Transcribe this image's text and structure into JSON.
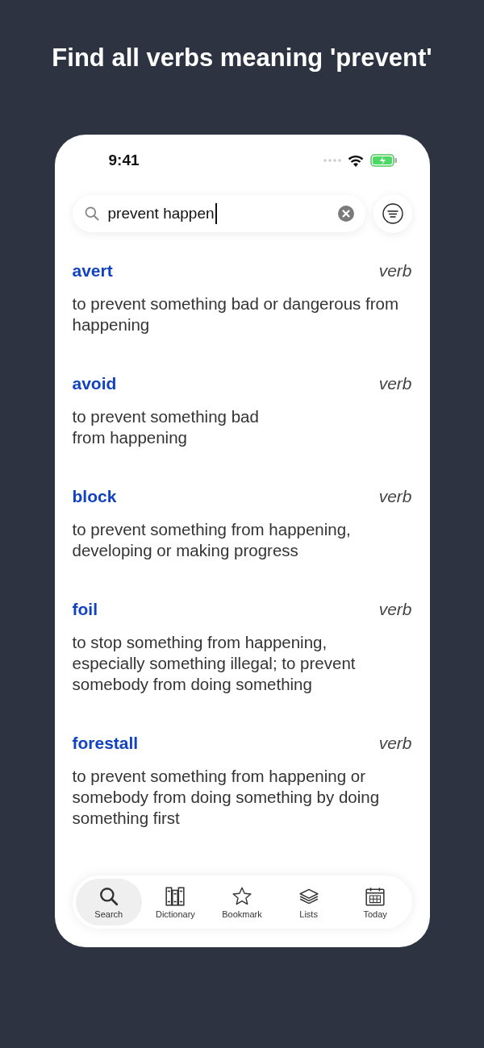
{
  "headline": "Find all verbs meaning 'prevent'",
  "status_bar": {
    "time": "9:41"
  },
  "search": {
    "value": "prevent happen"
  },
  "results": [
    {
      "word": "avert",
      "pos": "verb",
      "definition": "to prevent something bad or dangerous from happening"
    },
    {
      "word": "avoid",
      "pos": "verb",
      "definition": "to prevent something bad\nfrom happening"
    },
    {
      "word": "block",
      "pos": "verb",
      "definition": "to prevent something from happening, developing or making progress"
    },
    {
      "word": "foil",
      "pos": "verb",
      "definition": "to stop something from happening, especially something illegal; to prevent somebody from doing something"
    },
    {
      "word": "forestall",
      "pos": "verb",
      "definition": "to prevent something from happening or somebody from doing something by doing something first"
    }
  ],
  "tabs": [
    {
      "label": "Search",
      "kind": "search",
      "selected": true
    },
    {
      "label": "Dictionary",
      "kind": "dictionary",
      "selected": false
    },
    {
      "label": "Bookmark",
      "kind": "bookmark",
      "selected": false
    },
    {
      "label": "Lists",
      "kind": "lists",
      "selected": false
    },
    {
      "label": "Today",
      "kind": "today",
      "selected": false
    }
  ]
}
